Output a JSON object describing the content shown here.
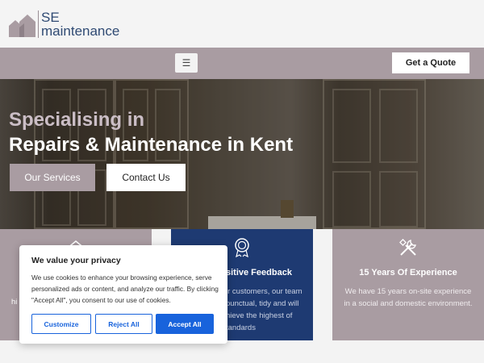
{
  "brand": {
    "line1": "SE",
    "line2": "maintenance"
  },
  "nav": {
    "menu_icon": "bars-icon",
    "quote_label": "Get a Quote"
  },
  "hero": {
    "title_line1": "Specialising in",
    "title_line2": "Repairs & Maintenance in Kent",
    "services_label": "Our Services",
    "contact_label": "Contact Us"
  },
  "cards": [
    {
      "icon": "house-outline-icon",
      "partial_text": "hi"
    },
    {
      "icon": "award-badge-icon",
      "title": "sitive Feedback",
      "lines": [
        "ir customers, our team",
        "punctual, tidy and will",
        "hieve the highest of",
        "tandards"
      ]
    },
    {
      "icon": "tools-icon",
      "title": "15 Years Of Experience",
      "lines": [
        "We have 15 years on-site experience",
        "in a social and domestic environment."
      ]
    }
  ],
  "cookie": {
    "title": "We value your privacy",
    "text": "We use cookies to enhance your browsing experience, serve personalized ads or content, and analyze our traffic. By clicking \"Accept All\", you consent to our use of cookies.",
    "customize_label": "Customize",
    "reject_label": "Reject All",
    "accept_label": "Accept All"
  },
  "colors": {
    "brand_navy": "#2f4a73",
    "mauve": "#a99ca2",
    "card_blue": "#1e3a72",
    "accept_blue": "#1863dc"
  }
}
